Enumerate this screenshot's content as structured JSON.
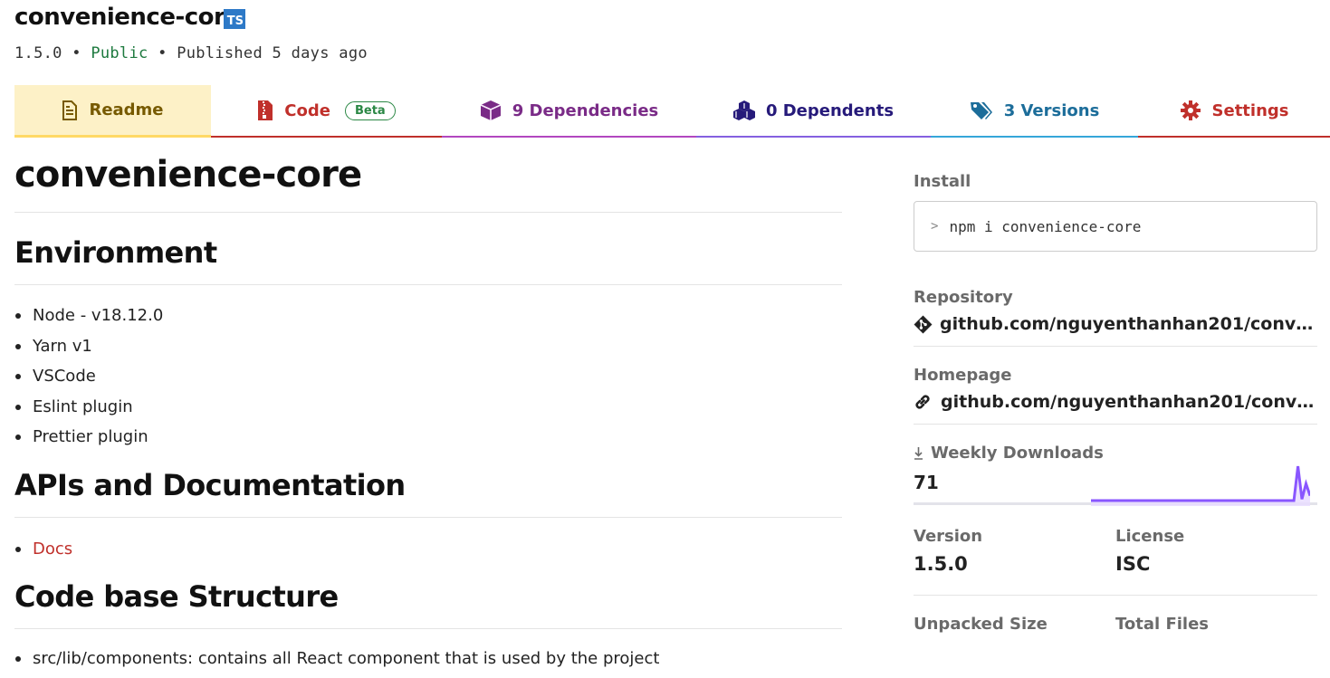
{
  "package": {
    "name": "convenience-core",
    "ts_badge": "TS",
    "version": "1.5.0",
    "bullet": "•",
    "visibility": "Public",
    "published": "Published 5 days ago"
  },
  "tabs": {
    "readme": "Readme",
    "code": "Code",
    "code_badge": "Beta",
    "dependencies": "9 Dependencies",
    "dependents": "0 Dependents",
    "versions": "3 Versions",
    "settings": "Settings"
  },
  "readme": {
    "title": "convenience-core",
    "environment_heading": "Environment",
    "environment_items": [
      "Node - v18.12.0",
      "Yarn v1",
      "VSCode",
      "Eslint plugin",
      "Prettier plugin"
    ],
    "apis_heading": "APIs and Documentation",
    "docs_link": "Docs",
    "structure_heading": "Code base Structure",
    "structure_items": [
      "src/lib/components: contains all React component that is used by the project"
    ]
  },
  "sidebar": {
    "install_label": "Install",
    "install_prompt": ">",
    "install_command": "npm i convenience-core",
    "repository_label": "Repository",
    "repository_url": "github.com/nguyenthanhan201/conven…",
    "homepage_label": "Homepage",
    "homepage_url": "github.com/nguyenthanhan201/conven…",
    "weekly_downloads_label": "Weekly Downloads",
    "weekly_downloads": "71",
    "sparkline": [
      0,
      0,
      0,
      0,
      0,
      0,
      0,
      0,
      0,
      0,
      0,
      0,
      0,
      0,
      0,
      0,
      0,
      0,
      0,
      0,
      0,
      0,
      0,
      0,
      0,
      0,
      0,
      0,
      0,
      0,
      0,
      0,
      0,
      0,
      0,
      0,
      0,
      0,
      0,
      0,
      0,
      0,
      0,
      0,
      0,
      0,
      0,
      0,
      0,
      0,
      0,
      71,
      3,
      35,
      10
    ],
    "version_label": "Version",
    "version_value": "1.5.0",
    "license_label": "License",
    "license_value": "ISC",
    "unpacked_size_label": "Unpacked Size",
    "total_files_label": "Total Files"
  },
  "colors": {
    "accent_red": "#c0302b",
    "readme_tab_bg": "#fdf1c7",
    "spark_line": "#8956ff",
    "public_green": "#1e7a3f"
  }
}
